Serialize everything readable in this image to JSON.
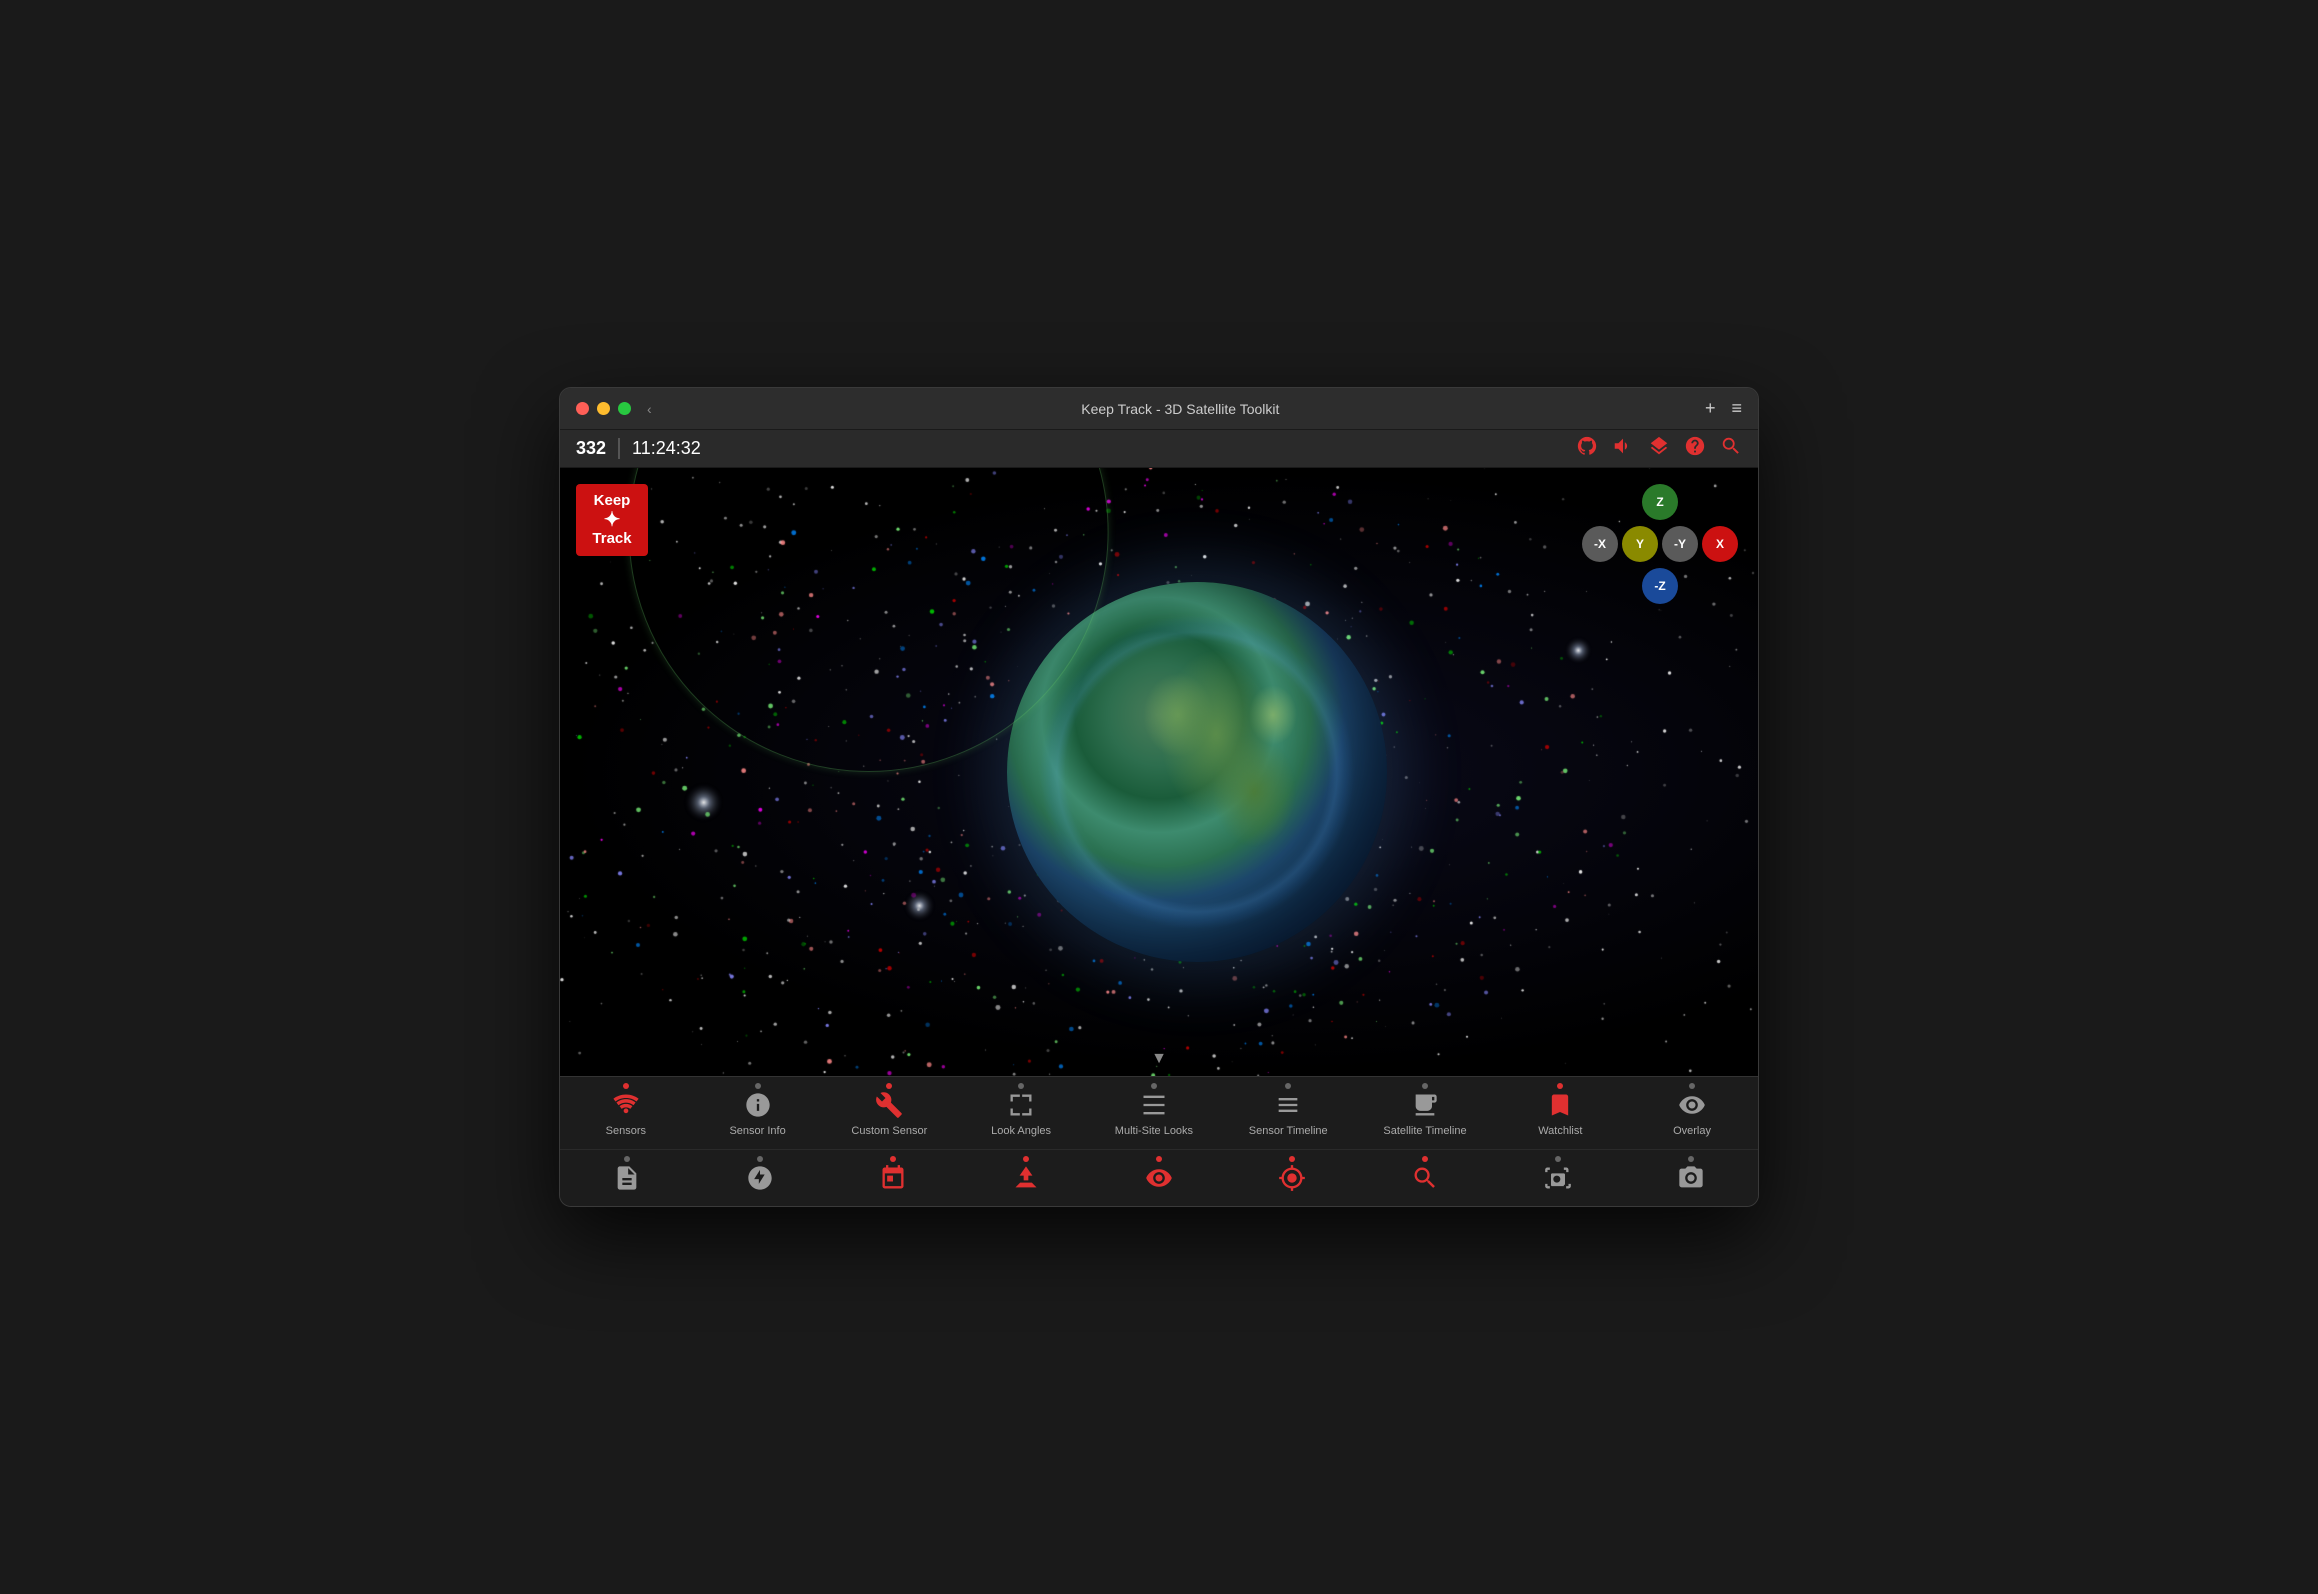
{
  "window": {
    "title": "Keep Track - 3D Satellite Toolkit"
  },
  "toolbar": {
    "sat_count": "332",
    "time": "11:24:32"
  },
  "logo": {
    "line1": "Keep",
    "line2": "Track"
  },
  "axis_buttons": {
    "z_top": "Z",
    "x_neg": "-X",
    "y_pos": "Y",
    "y_neg": "-Y",
    "x_pos": "X",
    "z_neg": "-Z"
  },
  "tools_row1": [
    {
      "id": "sensors",
      "label": "Sensors",
      "color": "red",
      "dot": "red"
    },
    {
      "id": "sensor-info",
      "label": "Sensor Info",
      "color": "gray",
      "dot": "gray"
    },
    {
      "id": "custom-sensor",
      "label": "Custom Sensor",
      "color": "red",
      "dot": "red"
    },
    {
      "id": "look-angles",
      "label": "Look Angles",
      "color": "gray",
      "dot": "gray"
    },
    {
      "id": "multi-site-looks",
      "label": "Multi-Site Looks",
      "color": "gray",
      "dot": "gray"
    },
    {
      "id": "sensor-timeline",
      "label": "Sensor Timeline",
      "color": "gray",
      "dot": "gray"
    },
    {
      "id": "satellite-timeline",
      "label": "Satellite Timeline",
      "color": "gray",
      "dot": "gray"
    },
    {
      "id": "watchlist",
      "label": "Watchlist",
      "color": "red",
      "dot": "red"
    },
    {
      "id": "overlay",
      "label": "Overlay",
      "color": "gray",
      "dot": "gray"
    }
  ],
  "tools_row2": [
    {
      "id": "file",
      "label": "",
      "color": "gray",
      "dot": "gray"
    },
    {
      "id": "radar",
      "label": "",
      "color": "gray",
      "dot": "gray"
    },
    {
      "id": "calendar",
      "label": "",
      "color": "red",
      "dot": "red"
    },
    {
      "id": "launch",
      "label": "",
      "color": "red",
      "dot": "red"
    },
    {
      "id": "satellite-eye",
      "label": "",
      "color": "red",
      "dot": "red"
    },
    {
      "id": "tracking",
      "label": "",
      "color": "red",
      "dot": "red"
    },
    {
      "id": "analysis",
      "label": "",
      "color": "red",
      "dot": "red"
    },
    {
      "id": "scan1",
      "label": "",
      "color": "gray",
      "dot": "gray"
    },
    {
      "id": "scan2",
      "label": "",
      "color": "gray",
      "dot": "gray"
    }
  ]
}
